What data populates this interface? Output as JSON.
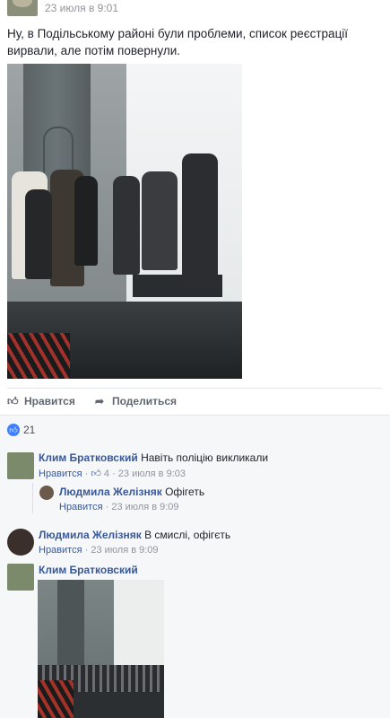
{
  "post": {
    "timestamp": "23 июля в 9:01",
    "text": "Ну, в Подільському районі були проблеми, список реєстрації вирвали, але потім повернули."
  },
  "actions": {
    "like": "Нравится",
    "share": "Поделиться"
  },
  "reactions": {
    "count": "21"
  },
  "comments": [
    {
      "author": "Клим Братковский",
      "text": "Навіть поліцію викликали",
      "like": "Нравится",
      "likes": "4",
      "time": "23 июля в 9:03",
      "replies": [
        {
          "author": "Людмила Желізняк",
          "text": "Офігеть",
          "like": "Нравится",
          "time": "23 июля в 9:09"
        }
      ]
    },
    {
      "author": "Людмила Желізняк",
      "text": "В смислі, офігєть",
      "like": "Нравится",
      "time": "23 июля в 9:09"
    },
    {
      "author": "Клим Братковский",
      "text": ""
    }
  ],
  "colors": {
    "link": "#385898",
    "meta": "#90949c",
    "like_blue": "#4080ff"
  }
}
